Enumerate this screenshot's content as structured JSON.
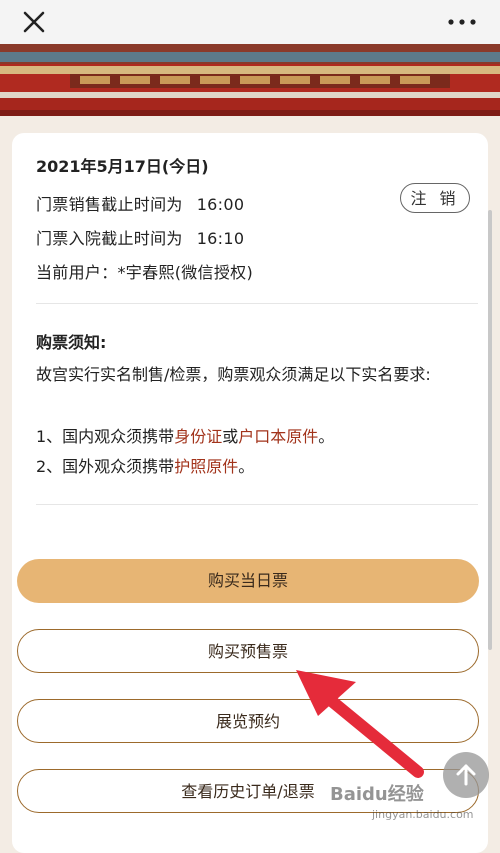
{
  "ticket_info": {
    "date": "2021年5月17日(今日)",
    "sale_deadline_label": "门票销售截止时间为",
    "sale_deadline_time": "16:00",
    "entry_deadline_label": "门票入院截止时间为",
    "entry_deadline_time": "16:10",
    "current_user": "当前用户：*宇春熙(微信授权)",
    "logout_label": "注 销"
  },
  "notice": {
    "title": "购票须知:",
    "intro": "故宫实行实名制售/检票，购票观众须满足以下实名要求:",
    "item1_prefix": "1、国内观众须携带",
    "item1_id": "身份证",
    "item1_or": "或",
    "item1_hukou": "户口本原件",
    "item1_end": "。",
    "item2_prefix": "2、国外观众须携带",
    "item2_passport": "护照原件",
    "item2_end": "。"
  },
  "actions": {
    "buy_today": "购买当日票",
    "buy_presale": "购买预售票",
    "exhibition_booking": "展览预约",
    "order_history": "查看历史订单/退票"
  },
  "watermark": {
    "text": "Baidu经验",
    "sub": "jingyan.baidu.com"
  },
  "colors": {
    "primary_button": "#e7b574",
    "outline_border": "#9c6a2c",
    "highlight_text": "#a2331b",
    "banner_red": "#b8231f",
    "annotation_arrow": "#e52b3a"
  }
}
